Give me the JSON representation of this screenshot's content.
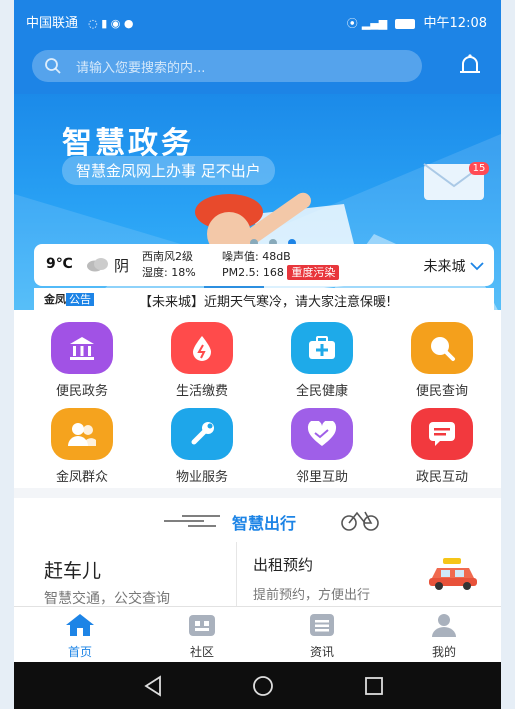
{
  "status_bar": {
    "carrier": "中国联通",
    "right_text": "中午12:08"
  },
  "search": {
    "placeholder": "请输入您要搜索的内..."
  },
  "banner": {
    "title": "智慧政务",
    "subtitle": "智慧金凤网上办事 足不出户",
    "badge_count": "15"
  },
  "weather": {
    "temp": "9℃",
    "condition": "阴",
    "wind": "西南风2级",
    "humidity": "湿度: 18%",
    "noise": "噪声值: 48dB",
    "pm25": "PM2.5: 168",
    "pollution": "重度污染",
    "city": "未来城"
  },
  "notice": {
    "brand": "金凤",
    "tag": "公告",
    "text": "【未来城】近期天气寒冷，请大家注意保暖!"
  },
  "services": [
    {
      "label": "便民政务",
      "color": "#a152e5"
    },
    {
      "label": "生活缴费",
      "color": "#ff4b4b"
    },
    {
      "label": "全民健康",
      "color": "#1eaae9"
    },
    {
      "label": "便民查询",
      "color": "#f4a01c"
    },
    {
      "label": "金凤群众",
      "color": "#f5a31e"
    },
    {
      "label": "物业服务",
      "color": "#1ea6ea"
    },
    {
      "label": "邻里互助",
      "color": "#9f5fe8"
    },
    {
      "label": "政民互动",
      "color": "#f2393e"
    }
  ],
  "travel": {
    "title": "智慧出行",
    "left_title": "赶车儿",
    "left_sub": "智慧交通，公交查询",
    "right_title": "出租预约",
    "right_sub": "提前预约，方便出行"
  },
  "tabs": [
    {
      "label": "首页",
      "icon": "home-icon",
      "active": true
    },
    {
      "label": "社区",
      "icon": "community-icon"
    },
    {
      "label": "资讯",
      "icon": "news-icon"
    },
    {
      "label": "我的",
      "icon": "profile-icon"
    }
  ],
  "colors": {
    "primary": "#1d84e6",
    "pollution": "#e8363c"
  }
}
